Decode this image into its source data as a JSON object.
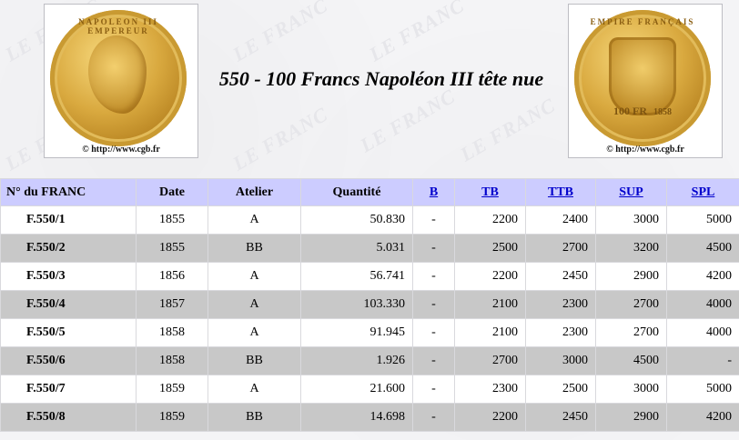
{
  "header": {
    "title": "550 - 100 Francs Napoléon III tête nue",
    "watermark": "LE FRANC",
    "left_coin": {
      "credit": "© http://www.cgb.fr",
      "legend": "NAPOLEON III EMPEREUR"
    },
    "right_coin": {
      "credit": "© http://www.cgb.fr",
      "legend": "EMPIRE FRANÇAIS",
      "value": "100 FR",
      "year": "1858"
    }
  },
  "table": {
    "headers": {
      "code": "N° du FRANC",
      "date": "Date",
      "atelier": "Atelier",
      "quantite": "Quantité",
      "b": "B",
      "tb": "TB",
      "ttb": "TTB",
      "sup": "SUP",
      "spl": "SPL"
    },
    "rows": [
      {
        "code": "F.550/1",
        "date": "1855",
        "atelier": "A",
        "quantite": "50.830",
        "b": "-",
        "tb": "2200",
        "ttb": "2400",
        "sup": "3000",
        "spl": "5000"
      },
      {
        "code": "F.550/2",
        "date": "1855",
        "atelier": "BB",
        "quantite": "5.031",
        "b": "-",
        "tb": "2500",
        "ttb": "2700",
        "sup": "3200",
        "spl": "4500"
      },
      {
        "code": "F.550/3",
        "date": "1856",
        "atelier": "A",
        "quantite": "56.741",
        "b": "-",
        "tb": "2200",
        "ttb": "2450",
        "sup": "2900",
        "spl": "4200"
      },
      {
        "code": "F.550/4",
        "date": "1857",
        "atelier": "A",
        "quantite": "103.330",
        "b": "-",
        "tb": "2100",
        "ttb": "2300",
        "sup": "2700",
        "spl": "4000"
      },
      {
        "code": "F.550/5",
        "date": "1858",
        "atelier": "A",
        "quantite": "91.945",
        "b": "-",
        "tb": "2100",
        "ttb": "2300",
        "sup": "2700",
        "spl": "4000"
      },
      {
        "code": "F.550/6",
        "date": "1858",
        "atelier": "BB",
        "quantite": "1.926",
        "b": "-",
        "tb": "2700",
        "ttb": "3000",
        "sup": "4500",
        "spl": "-"
      },
      {
        "code": "F.550/7",
        "date": "1859",
        "atelier": "A",
        "quantite": "21.600",
        "b": "-",
        "tb": "2300",
        "ttb": "2500",
        "sup": "3000",
        "spl": "5000"
      },
      {
        "code": "F.550/8",
        "date": "1859",
        "atelier": "BB",
        "quantite": "14.698",
        "b": "-",
        "tb": "2200",
        "ttb": "2450",
        "sup": "2900",
        "spl": "4200"
      }
    ]
  },
  "colors": {
    "header_bg": "#ccccff",
    "row_alt_bg": "#c8c8c8",
    "link": "#0000cc"
  }
}
